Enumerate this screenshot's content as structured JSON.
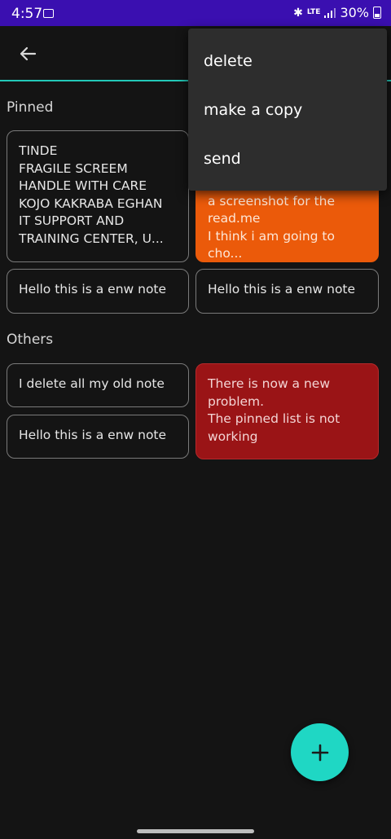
{
  "status_bar": {
    "time": "4:57",
    "network": "LTE",
    "battery": "30%"
  },
  "sections": {
    "pinned": "Pinned",
    "others": "Others"
  },
  "pinned_notes": [
    {
      "text": "TINDE\nFRAGILE SCREEM\nHANDLE WITH CARE\nKOJO KAKRABA EGHAN\nIT SUPPORT AND\nTRAINING CENTER, U..."
    },
    {
      "text": "spaces before taking\na screenshot for the\nread.me\nI think i am going to cho...",
      "color": "#eb5a0a"
    },
    {
      "text": "Hello this is a enw note"
    },
    {
      "text": "Hello this is a enw note"
    }
  ],
  "other_notes": [
    {
      "text": "I delete all my old note"
    },
    {
      "text": "There is now a new\nproblem.\nThe pinned list is not\nworking",
      "color": "#9a1416"
    },
    {
      "text": "Hello this is a enw note"
    }
  ],
  "menu": {
    "items": [
      "delete",
      "make a copy",
      "send"
    ]
  },
  "colors": {
    "status_bar": "#3a0fb0",
    "accent": "#1fd7c4",
    "background": "#141414"
  }
}
